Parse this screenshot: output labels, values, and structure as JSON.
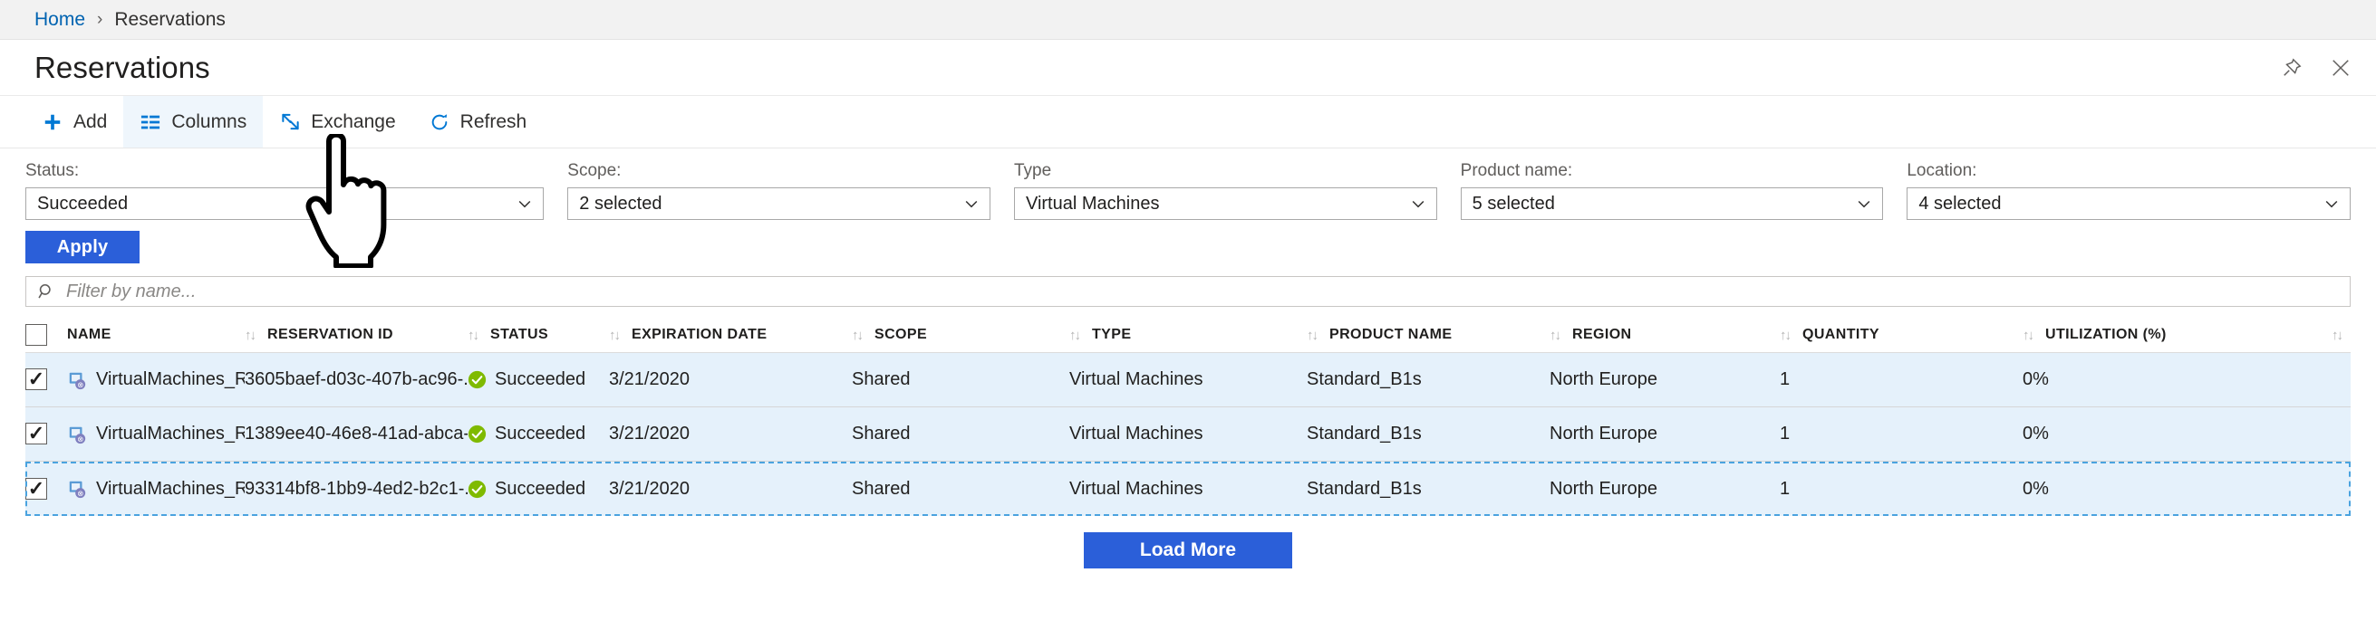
{
  "breadcrumb": {
    "home": "Home",
    "separator": "›",
    "current": "Reservations"
  },
  "header": {
    "title": "Reservations",
    "pin_icon": "pin-icon",
    "close_icon": "close-icon"
  },
  "toolbar": {
    "buttons": [
      {
        "label": "Add",
        "icon": "plus-icon",
        "highlighted": false
      },
      {
        "label": "Columns",
        "icon": "columns-icon",
        "highlighted": true
      },
      {
        "label": "Exchange",
        "icon": "exchange-arrows-icon",
        "highlighted": false
      },
      {
        "label": "Refresh",
        "icon": "refresh-icon",
        "highlighted": false
      }
    ]
  },
  "filters": [
    {
      "label": "Status:",
      "value": "Succeeded"
    },
    {
      "label": "Scope:",
      "value": "2 selected"
    },
    {
      "label": "Type",
      "value": "Virtual Machines"
    },
    {
      "label": "Product name:",
      "value": "5 selected"
    },
    {
      "label": "Location:",
      "value": "4 selected"
    }
  ],
  "apply": {
    "label": "Apply"
  },
  "search": {
    "placeholder": "Filter by name...",
    "value": "",
    "icon": "search-icon"
  },
  "table": {
    "sort_icon": "↑↓",
    "columns": [
      "NAME",
      "RESERVATION ID",
      "STATUS",
      "EXPIRATION DATE",
      "SCOPE",
      "TYPE",
      "PRODUCT NAME",
      "REGION",
      "QUANTITY",
      "UTILIZATION (%)"
    ],
    "rows": [
      {
        "checked": true,
        "name": "VirtualMachines_Reserv...",
        "reservation_id": "3605baef-d03c-407b-ac96-...",
        "status": "Succeeded",
        "expiration_date": "3/21/2020",
        "scope": "Shared",
        "type": "Virtual Machines",
        "product_name": "Standard_B1s",
        "region": "North Europe",
        "quantity": "1",
        "utilization": "0%"
      },
      {
        "checked": true,
        "name": "VirtualMachines_Reserv...",
        "reservation_id": "1389ee40-46e8-41ad-abca-...",
        "status": "Succeeded",
        "expiration_date": "3/21/2020",
        "scope": "Shared",
        "type": "Virtual Machines",
        "product_name": "Standard_B1s",
        "region": "North Europe",
        "quantity": "1",
        "utilization": "0%"
      },
      {
        "checked": true,
        "name": "VirtualMachines_Reserv...",
        "reservation_id": "93314bf8-1bb9-4ed2-b2c1-...",
        "status": "Succeeded",
        "expiration_date": "3/21/2020",
        "scope": "Shared",
        "type": "Virtual Machines",
        "product_name": "Standard_B1s",
        "region": "North Europe",
        "quantity": "1",
        "utilization": "0%"
      }
    ]
  },
  "load_more": {
    "label": "Load More"
  },
  "colors": {
    "accent_blue": "#0078d4",
    "button_blue": "#2b5fd9",
    "link_blue": "#0063b1",
    "row_selected": "#e5f1fb",
    "success_green": "#7fba00"
  },
  "cursor": {
    "icon": "hand-pointer-cursor"
  }
}
